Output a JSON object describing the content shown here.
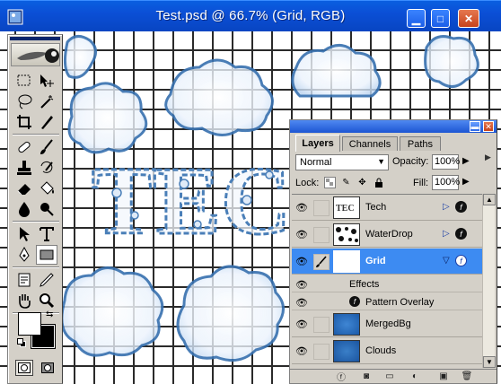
{
  "window": {
    "title": "Test.psd @ 66.7% (Grid, RGB)",
    "minimize": "▁",
    "maximize": "□",
    "close": "✕"
  },
  "artwork": {
    "text": "TEC"
  },
  "toolbox": {
    "tools": [
      "marquee-tool",
      "move-tool",
      "lasso-tool",
      "magic-wand-tool",
      "crop-tool",
      "slice-tool",
      "healing-brush-tool",
      "brush-tool",
      "clone-stamp-tool",
      "history-brush-tool",
      "eraser-tool",
      "paint-bucket-tool",
      "blur-tool",
      "dodge-tool",
      "path-selection-tool",
      "type-tool",
      "pen-tool",
      "rectangle-tool",
      "notes-tool",
      "eyedropper-tool",
      "hand-tool",
      "zoom-tool"
    ],
    "foreground_color": "#ffffff",
    "background_color": "#000000"
  },
  "layers_panel": {
    "tabs": [
      "Layers",
      "Channels",
      "Paths"
    ],
    "active_tab": "Layers",
    "blend_mode": "Normal",
    "opacity_label": "Opacity:",
    "opacity_value": "100%",
    "lock_label": "Lock:",
    "fill_label": "Fill:",
    "fill_value": "100%",
    "layers": [
      {
        "name": "Tech",
        "visible": true,
        "has_effects": true,
        "selected": false
      },
      {
        "name": "WaterDrop",
        "visible": true,
        "has_effects": true,
        "selected": false
      },
      {
        "name": "Grid",
        "visible": true,
        "has_effects": true,
        "selected": true
      },
      {
        "name": "MergedBg",
        "visible": true,
        "has_effects": false,
        "selected": false
      },
      {
        "name": "Clouds",
        "visible": true,
        "has_effects": false,
        "selected": false
      }
    ],
    "effects_label": "Effects",
    "effect_items": [
      "Pattern Overlay"
    ],
    "colors": {
      "selection": "#3d8bf2",
      "panel_bg": "#d4d0c8"
    }
  },
  "colors": {
    "title_bar": "#0b4fd6",
    "cloud_stroke": "#3a72b0",
    "cloud_fill": "#e8f1fb"
  }
}
